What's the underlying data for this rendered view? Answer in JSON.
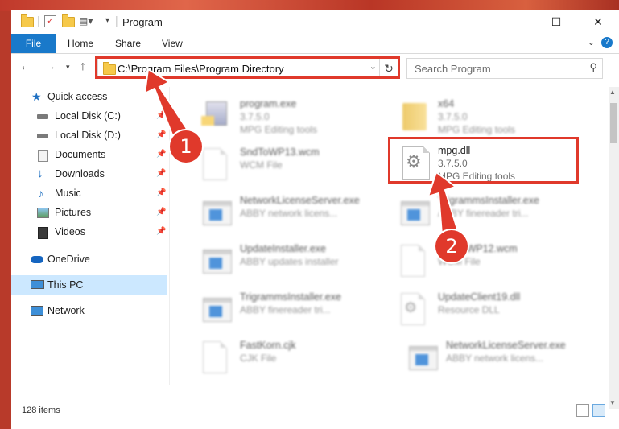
{
  "window": {
    "title": "Program",
    "controls": {
      "minimize": "—",
      "maximize": "☐",
      "close": "✕"
    }
  },
  "ribbon": {
    "tabs": [
      "File",
      "Home",
      "Share",
      "View"
    ],
    "help": "?"
  },
  "address_bar": {
    "path": "C:\\Program Files\\Program Directory",
    "refresh_icon": "↻"
  },
  "search": {
    "placeholder": "Search Program"
  },
  "nav_pane": {
    "items": [
      {
        "label": "Quick access",
        "icon": "star-icon",
        "pinned": false
      },
      {
        "label": "Local Disk (C:)",
        "icon": "drive-icon",
        "pinned": true
      },
      {
        "label": "Local Disk (D:)",
        "icon": "drive-icon",
        "pinned": true
      },
      {
        "label": "Documents",
        "icon": "documents-icon",
        "pinned": true
      },
      {
        "label": "Downloads",
        "icon": "download-icon",
        "pinned": true
      },
      {
        "label": "Music",
        "icon": "music-icon",
        "pinned": true
      },
      {
        "label": "Pictures",
        "icon": "pictures-icon",
        "pinned": true
      },
      {
        "label": "Videos",
        "icon": "video-icon",
        "pinned": true
      },
      {
        "label": "OneDrive",
        "icon": "cloud-icon",
        "pinned": false
      },
      {
        "label": "This PC",
        "icon": "computer-icon",
        "pinned": false,
        "selected": true
      },
      {
        "label": "Network",
        "icon": "network-icon",
        "pinned": false
      }
    ]
  },
  "files": [
    {
      "name": "program.exe",
      "line2": "3.7.5.0",
      "line3": "MPG Editing tools",
      "icon": "installer-icon"
    },
    {
      "name": "x64",
      "line2": "3.7.5.0",
      "line3": "MPG Editing tools",
      "icon": "folder-icon"
    },
    {
      "name": "SndToWP13.wcm",
      "line2": "WCM File",
      "line3": "",
      "icon": "document-icon"
    },
    {
      "name": "mpg.dll",
      "line2": "3.7.5.0",
      "line3": "MPG Editing tools",
      "icon": "dll-gear-icon"
    },
    {
      "name": "NetworkLicenseServer.exe",
      "line2": "ABBY network licens...",
      "line3": "",
      "icon": "app-icon"
    },
    {
      "name": "TrigrammsInstaller.exe",
      "line2": "ABBY finereader tri...",
      "line3": "",
      "icon": "app-icon"
    },
    {
      "name": "UpdateInstaller.exe",
      "line2": "ABBY updates installer",
      "line3": "",
      "icon": "app-icon"
    },
    {
      "name": "SndToWP12.wcm",
      "line2": "WCM File",
      "line3": "",
      "icon": "document-icon"
    },
    {
      "name": "TrigrammsInstaller.exe",
      "line2": "ABBY finereader tri...",
      "line3": "",
      "icon": "app-icon"
    },
    {
      "name": "UpdateClient19.dll",
      "line2": "Resource DLL",
      "line3": "",
      "icon": "dll-gear-icon"
    },
    {
      "name": "FastKorn.cjk",
      "line2": "CJK File",
      "line3": "",
      "icon": "document-icon"
    },
    {
      "name": "NetworkLicenseServer.exe",
      "line2": "ABBY network licens...",
      "line3": "",
      "icon": "app-icon"
    }
  ],
  "status_bar": {
    "item_count": "128 items"
  },
  "annotations": {
    "step1": "1",
    "step2": "2",
    "color": "#e0392b"
  }
}
